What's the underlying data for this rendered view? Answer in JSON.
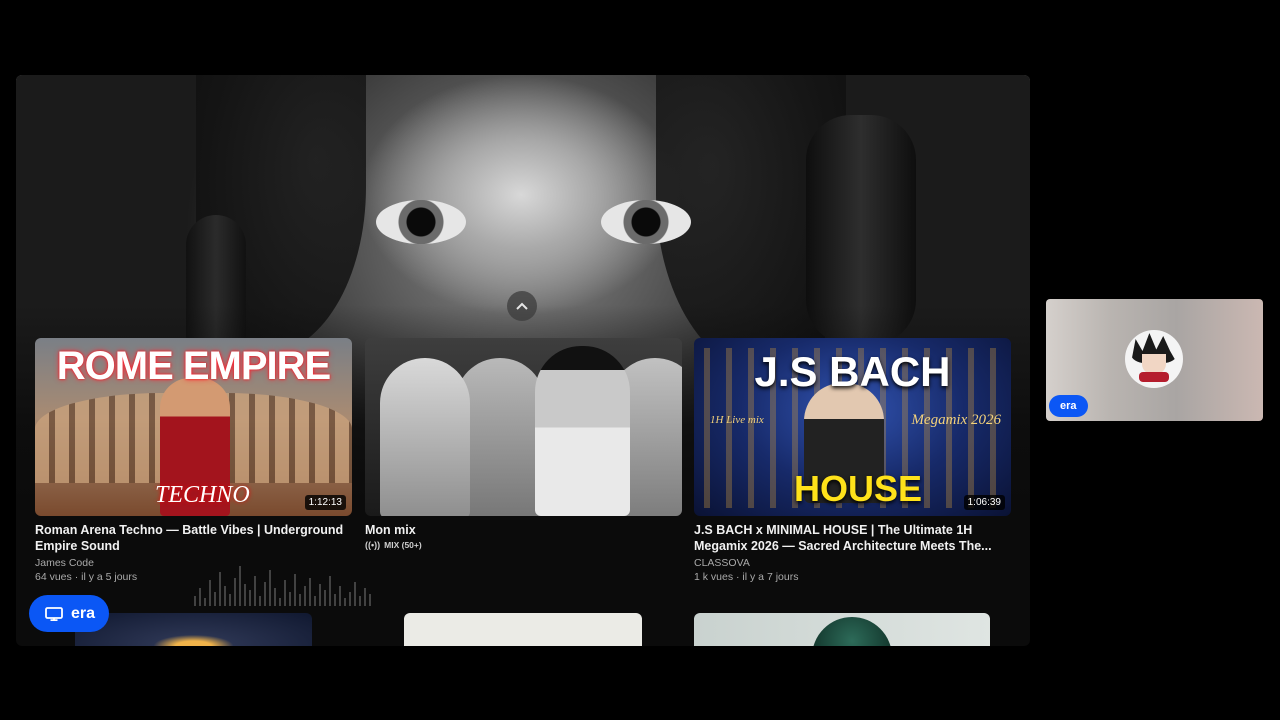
{
  "shared_screen": {
    "videos": [
      {
        "thumb_heading": "ROME EMPIRE",
        "thumb_sub": "TECHNO",
        "duration": "1:12:13",
        "title": "Roman Arena Techno — Battle Vibes | Underground Empire Sound",
        "channel": "James Code",
        "meta": "64 vues · il y a 5 jours"
      },
      {
        "duration": "",
        "title": "Mon mix",
        "badge": "MIX (50+)"
      },
      {
        "thumb_heading": "J.S BACH",
        "thumb_sub": "HOUSE",
        "thumb_tag_left": "1H Live mix",
        "thumb_tag_right": "Megamix 2026",
        "duration": "1:06:39",
        "title": "J.S BACH x MINIMAL HOUSE | The Ultimate 1H Megamix 2026 — Sacred Architecture Meets The...",
        "channel": "CLASSOVA",
        "meta": "1 k vues · il y a 7 jours"
      }
    ],
    "collapse_icon": "chevron-up-icon"
  },
  "presenter_chip": {
    "icon": "screen-share-icon",
    "label": "era"
  },
  "participant_tile": {
    "name": "era",
    "accent": "#0b57f5"
  }
}
